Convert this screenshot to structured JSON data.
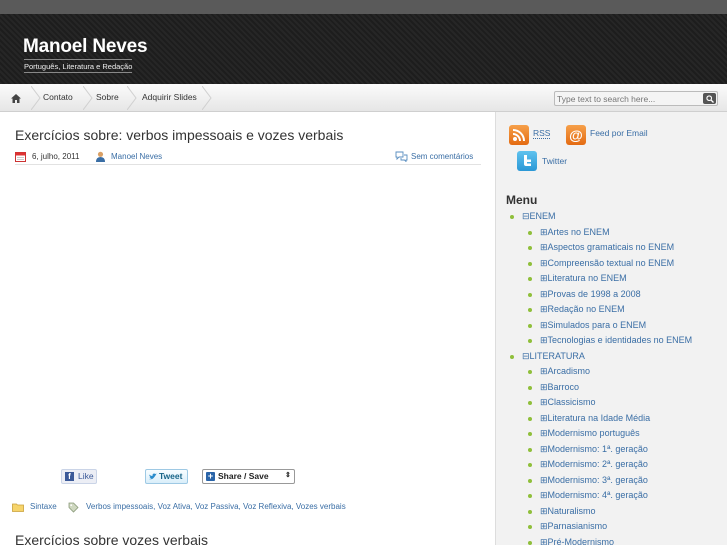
{
  "site": {
    "title": "Manoel Neves",
    "description": "Português, Literatura e Redação"
  },
  "nav": {
    "items": [
      "Contato",
      "Sobre",
      "Adquirir Slides"
    ],
    "search_placeholder": "Type text to search here..."
  },
  "post": {
    "title": "Exercícios sobre: verbos impessoais e vozes verbais",
    "date": "6, julho, 2011",
    "author": "Manoel Neves",
    "comments": "Sem comentários",
    "share": {
      "like": "Like",
      "tweet": "Tweet",
      "share_save": "Share / Save"
    },
    "category": "Sintaxe",
    "tags": "Verbos impessoais, Voz Ativa, Voz Passiva, Voz Reflexiva, Vozes verbais"
  },
  "next_post": {
    "title": "Exercícios sobre vozes verbais"
  },
  "sidebar": {
    "rss": "RSS",
    "feed_email": "Feed por Email",
    "twitter": "Twitter",
    "menu_title": "Menu",
    "menu": [
      {
        "label": "⊟ENEM",
        "level": 0
      },
      {
        "label": "⊞Artes no ENEM",
        "level": 1
      },
      {
        "label": "⊞Aspectos gramaticais no ENEM",
        "level": 1
      },
      {
        "label": "⊞Compreensão textual no ENEM",
        "level": 1
      },
      {
        "label": "⊞Literatura no ENEM",
        "level": 1
      },
      {
        "label": "⊞Provas de 1998 a 2008",
        "level": 1
      },
      {
        "label": "⊞Redação no ENEM",
        "level": 1
      },
      {
        "label": "⊞Simulados para o ENEM",
        "level": 1
      },
      {
        "label": "⊞Tecnologias e identidades no ENEM",
        "level": 1
      },
      {
        "label": "⊟LITERATURA",
        "level": 0
      },
      {
        "label": "⊞Arcadismo",
        "level": 1
      },
      {
        "label": "⊞Barroco",
        "level": 1
      },
      {
        "label": "⊞Classicismo",
        "level": 1
      },
      {
        "label": "⊞Literatura na Idade Média",
        "level": 1
      },
      {
        "label": "⊞Modernismo português",
        "level": 1
      },
      {
        "label": "⊞Modernismo: 1ª. geração",
        "level": 1
      },
      {
        "label": "⊞Modernismo: 2ª. geração",
        "level": 1
      },
      {
        "label": "⊞Modernismo: 3ª. geração",
        "level": 1
      },
      {
        "label": "⊞Modernismo: 4ª. geração",
        "level": 1
      },
      {
        "label": "⊞Naturalismo",
        "level": 1
      },
      {
        "label": "⊞Parnasianismo",
        "level": 1
      },
      {
        "label": "⊞Pré-Modernismo",
        "level": 1
      }
    ]
  },
  "icons": {
    "home": "home-icon",
    "calendar": "calendar-icon",
    "author": "user-icon",
    "comments": "comment-icon",
    "folder": "folder-icon",
    "tag": "tag-icon",
    "search": "search-icon"
  },
  "colors": {
    "link": "#3a6ea5",
    "bullet": "#8fbf3a",
    "header": "#222222"
  }
}
